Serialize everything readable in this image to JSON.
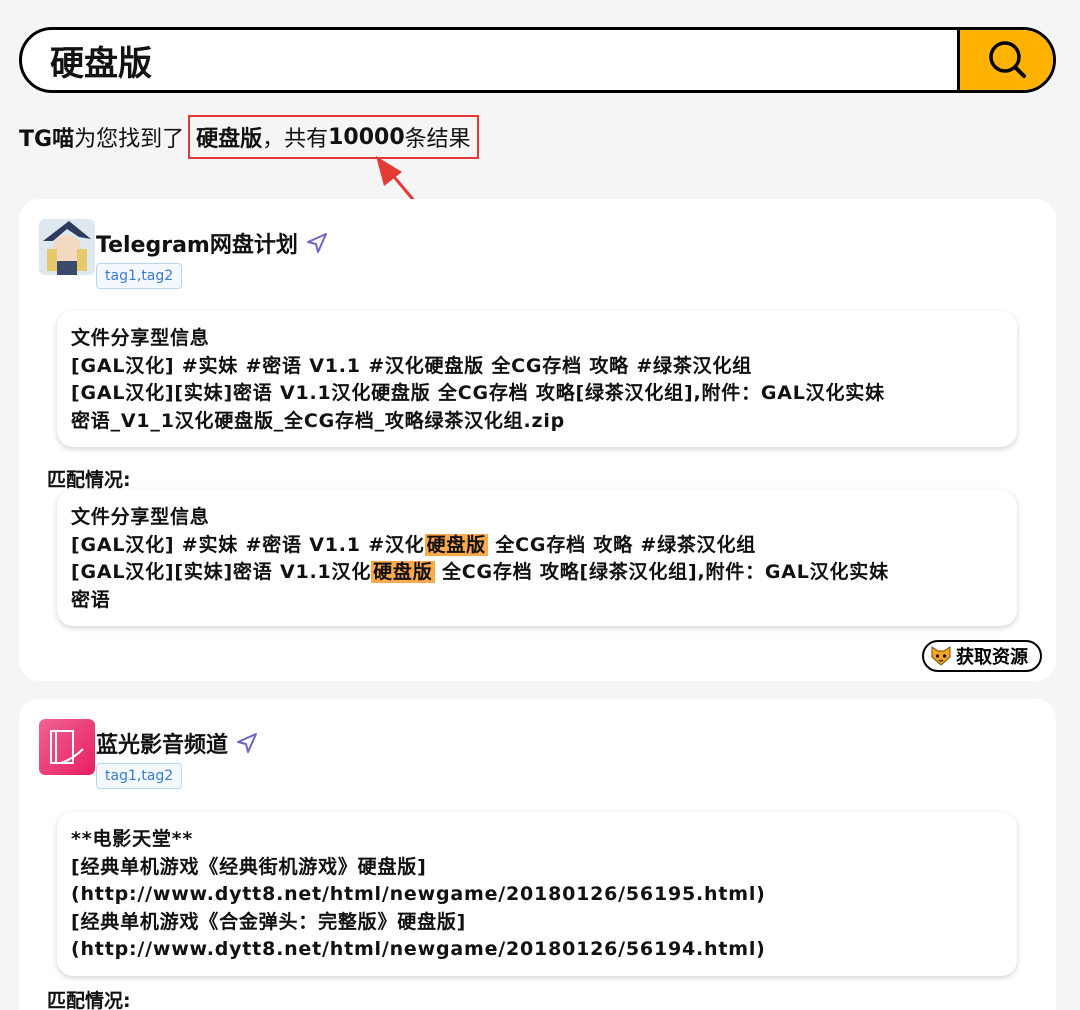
{
  "search": {
    "query": "硬盘版",
    "placeholder": "",
    "button_icon": "search-icon",
    "accent_color": "#ffb300"
  },
  "summary": {
    "brand": "TG喵",
    "text_before": "为您找到了",
    "keyword": "硬盘版",
    "text_middle": "，共有",
    "count": "10000",
    "text_after": "条结果",
    "annotation_color": "#e53935"
  },
  "results": [
    {
      "channel": "Telegram网盘计划",
      "tags": "tag1,tag2",
      "message_lines": [
        "文件分享型信息",
        "[GAL汉化] #实妹 #密语 V1.1 #汉化硬盘版 全CG存档 攻略 #绿茶汉化组",
        "[GAL汉化][实妹]密语 V1.1汉化硬盘版 全CG存档 攻略[绿茶汉化组],附件：GAL汉化实妹",
        "密语_V1_1汉化硬盘版_全CG存档_攻略绿茶汉化组.zip"
      ],
      "match_label": "匹配情况:",
      "match_lines": {
        "l1": "文件分享型信息",
        "l2_pre": "[GAL汉化] #实妹 #密语 V1.1 #汉化",
        "l2_hl": "硬盘版",
        "l2_post": " 全CG存档 攻略 #绿茶汉化组",
        "l3_pre": "[GAL汉化][实妹]密语 V1.1汉化",
        "l3_hl": "硬盘版",
        "l3_post": " 全CG存档 攻略[绿茶汉化组],附件：GAL汉化实妹",
        "l4": "密语"
      },
      "action_label": "获取资源"
    },
    {
      "channel": "蓝光影音频道",
      "tags": "tag1,tag2",
      "message_lines": [
        "**电影天堂**",
        "[经典单机游戏《经典街机游戏》硬盘版]",
        "(http://www.dytt8.net/html/newgame/20180126/56195.html)",
        "[经典单机游戏《合金弹头：完整版》硬盘版]",
        "(http://www.dytt8.net/html/newgame/20180126/56194.html)"
      ],
      "match_label": "匹配情况:"
    }
  ],
  "highlight_color": "#ffa94d"
}
